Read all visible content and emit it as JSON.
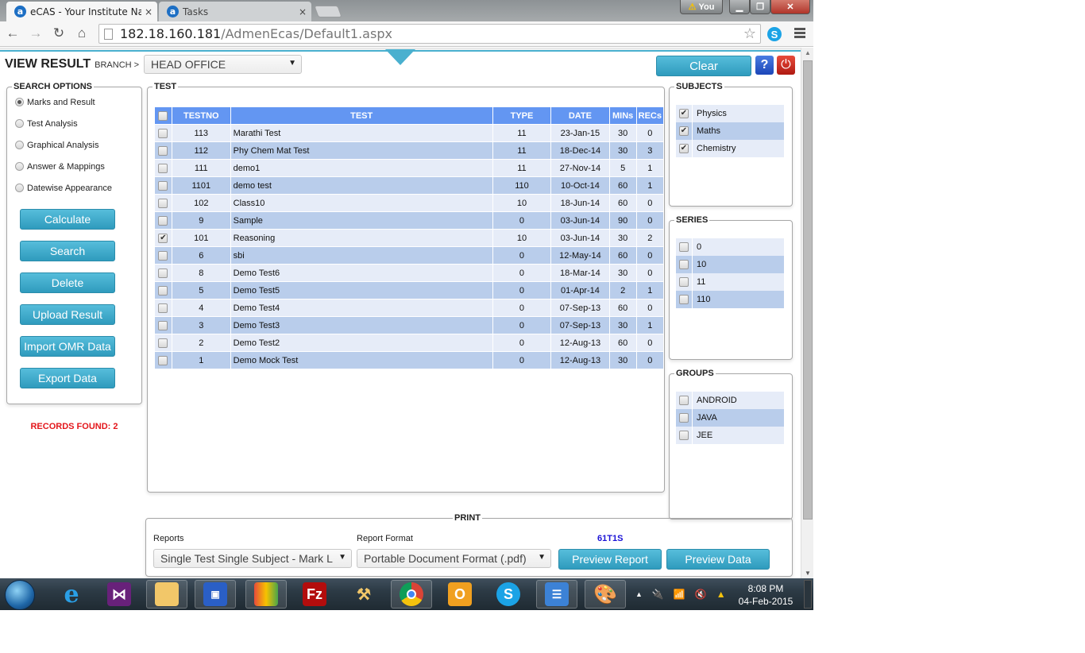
{
  "browser": {
    "tabs": [
      {
        "title": "eCAS - Your Institute Nam",
        "active": true,
        "favicon": "a"
      },
      {
        "title": "Tasks",
        "active": false,
        "favicon": "a"
      }
    ],
    "url_host": "182.18.160.181",
    "url_path": "/AdmenEcas/Default1.aspx",
    "profile_label": "You",
    "close_glyph": "×"
  },
  "header": {
    "title": "VIEW RESULT",
    "branch_label": "BRANCH >",
    "branch_value": "HEAD OFFICE",
    "clear_label": "Clear",
    "help_label": "?"
  },
  "search_options": {
    "legend": "SEARCH OPTIONS",
    "options": [
      {
        "label": "Marks and Result",
        "selected": true
      },
      {
        "label": "Test Analysis",
        "selected": false
      },
      {
        "label": "Graphical Analysis",
        "selected": false
      },
      {
        "label": "Answer & Mappings",
        "selected": false
      },
      {
        "label": "Datewise Appearance",
        "selected": false
      }
    ],
    "buttons": [
      "Calculate",
      "Search",
      "Delete",
      "Upload Result",
      "Import OMR Data",
      "Export Data"
    ],
    "records_found": "RECORDS FOUND: 2"
  },
  "test": {
    "legend": "TEST",
    "columns": [
      "TESTNO",
      "TEST",
      "TYPE",
      "DATE",
      "MINs",
      "RECs"
    ],
    "rows": [
      {
        "checked": false,
        "testno": "113",
        "test": "Marathi Test",
        "type": "11",
        "date": "23-Jan-15",
        "mins": "30",
        "recs": "0"
      },
      {
        "checked": false,
        "testno": "112",
        "test": "Phy Chem Mat Test",
        "type": "11",
        "date": "18-Dec-14",
        "mins": "30",
        "recs": "3"
      },
      {
        "checked": false,
        "testno": "111",
        "test": "demo1",
        "type": "11",
        "date": "27-Nov-14",
        "mins": "5",
        "recs": "1"
      },
      {
        "checked": false,
        "testno": "1101",
        "test": "demo test",
        "type": "110",
        "date": "10-Oct-14",
        "mins": "60",
        "recs": "1"
      },
      {
        "checked": false,
        "testno": "102",
        "test": "Class10",
        "type": "10",
        "date": "18-Jun-14",
        "mins": "60",
        "recs": "0"
      },
      {
        "checked": false,
        "testno": "9",
        "test": "Sample",
        "type": "0",
        "date": "03-Jun-14",
        "mins": "90",
        "recs": "0"
      },
      {
        "checked": true,
        "testno": "101",
        "test": "Reasoning",
        "type": "10",
        "date": "03-Jun-14",
        "mins": "30",
        "recs": "2"
      },
      {
        "checked": false,
        "testno": "6",
        "test": "sbi",
        "type": "0",
        "date": "12-May-14",
        "mins": "60",
        "recs": "0"
      },
      {
        "checked": false,
        "testno": "8",
        "test": "Demo Test6",
        "type": "0",
        "date": "18-Mar-14",
        "mins": "30",
        "recs": "0"
      },
      {
        "checked": false,
        "testno": "5",
        "test": "Demo Test5",
        "type": "0",
        "date": "01-Apr-14",
        "mins": "2",
        "recs": "1"
      },
      {
        "checked": false,
        "testno": "4",
        "test": "Demo Test4",
        "type": "0",
        "date": "07-Sep-13",
        "mins": "60",
        "recs": "0"
      },
      {
        "checked": false,
        "testno": "3",
        "test": "Demo Test3",
        "type": "0",
        "date": "07-Sep-13",
        "mins": "30",
        "recs": "1"
      },
      {
        "checked": false,
        "testno": "2",
        "test": "Demo Test2",
        "type": "0",
        "date": "12-Aug-13",
        "mins": "60",
        "recs": "0"
      },
      {
        "checked": false,
        "testno": "1",
        "test": "Demo Mock Test",
        "type": "0",
        "date": "12-Aug-13",
        "mins": "30",
        "recs": "0"
      }
    ]
  },
  "subjects": {
    "legend": "SUBJECTS",
    "items": [
      {
        "label": "Physics",
        "checked": true
      },
      {
        "label": "Maths",
        "checked": true
      },
      {
        "label": "Chemistry",
        "checked": true
      }
    ]
  },
  "series": {
    "legend": "SERIES",
    "items": [
      {
        "label": "0",
        "checked": false
      },
      {
        "label": "10",
        "checked": false
      },
      {
        "label": "11",
        "checked": false
      },
      {
        "label": "110",
        "checked": false
      }
    ]
  },
  "groups": {
    "legend": "GROUPS",
    "items": [
      {
        "label": "ANDROID",
        "checked": false
      },
      {
        "label": "JAVA",
        "checked": false
      },
      {
        "label": "JEE",
        "checked": false
      }
    ]
  },
  "print": {
    "legend": "PRINT",
    "reports_label": "Reports",
    "reports_value": "Single Test Single Subject - Mark L",
    "format_label": "Report Format",
    "format_value": "Portable Document Format (.pdf)",
    "code": "61T1S",
    "preview_report_label": "Preview Report",
    "preview_data_label": "Preview Data"
  },
  "taskbar": {
    "apps": [
      "start",
      "internet-explorer",
      "visual-studio",
      "file-explorer",
      "remote-desktop",
      "app-generic",
      "filezilla",
      "tools",
      "chrome",
      "outlook",
      "skype",
      "control-panel",
      "paint"
    ],
    "time": "8:08 PM",
    "date": "04-Feb-2015"
  }
}
